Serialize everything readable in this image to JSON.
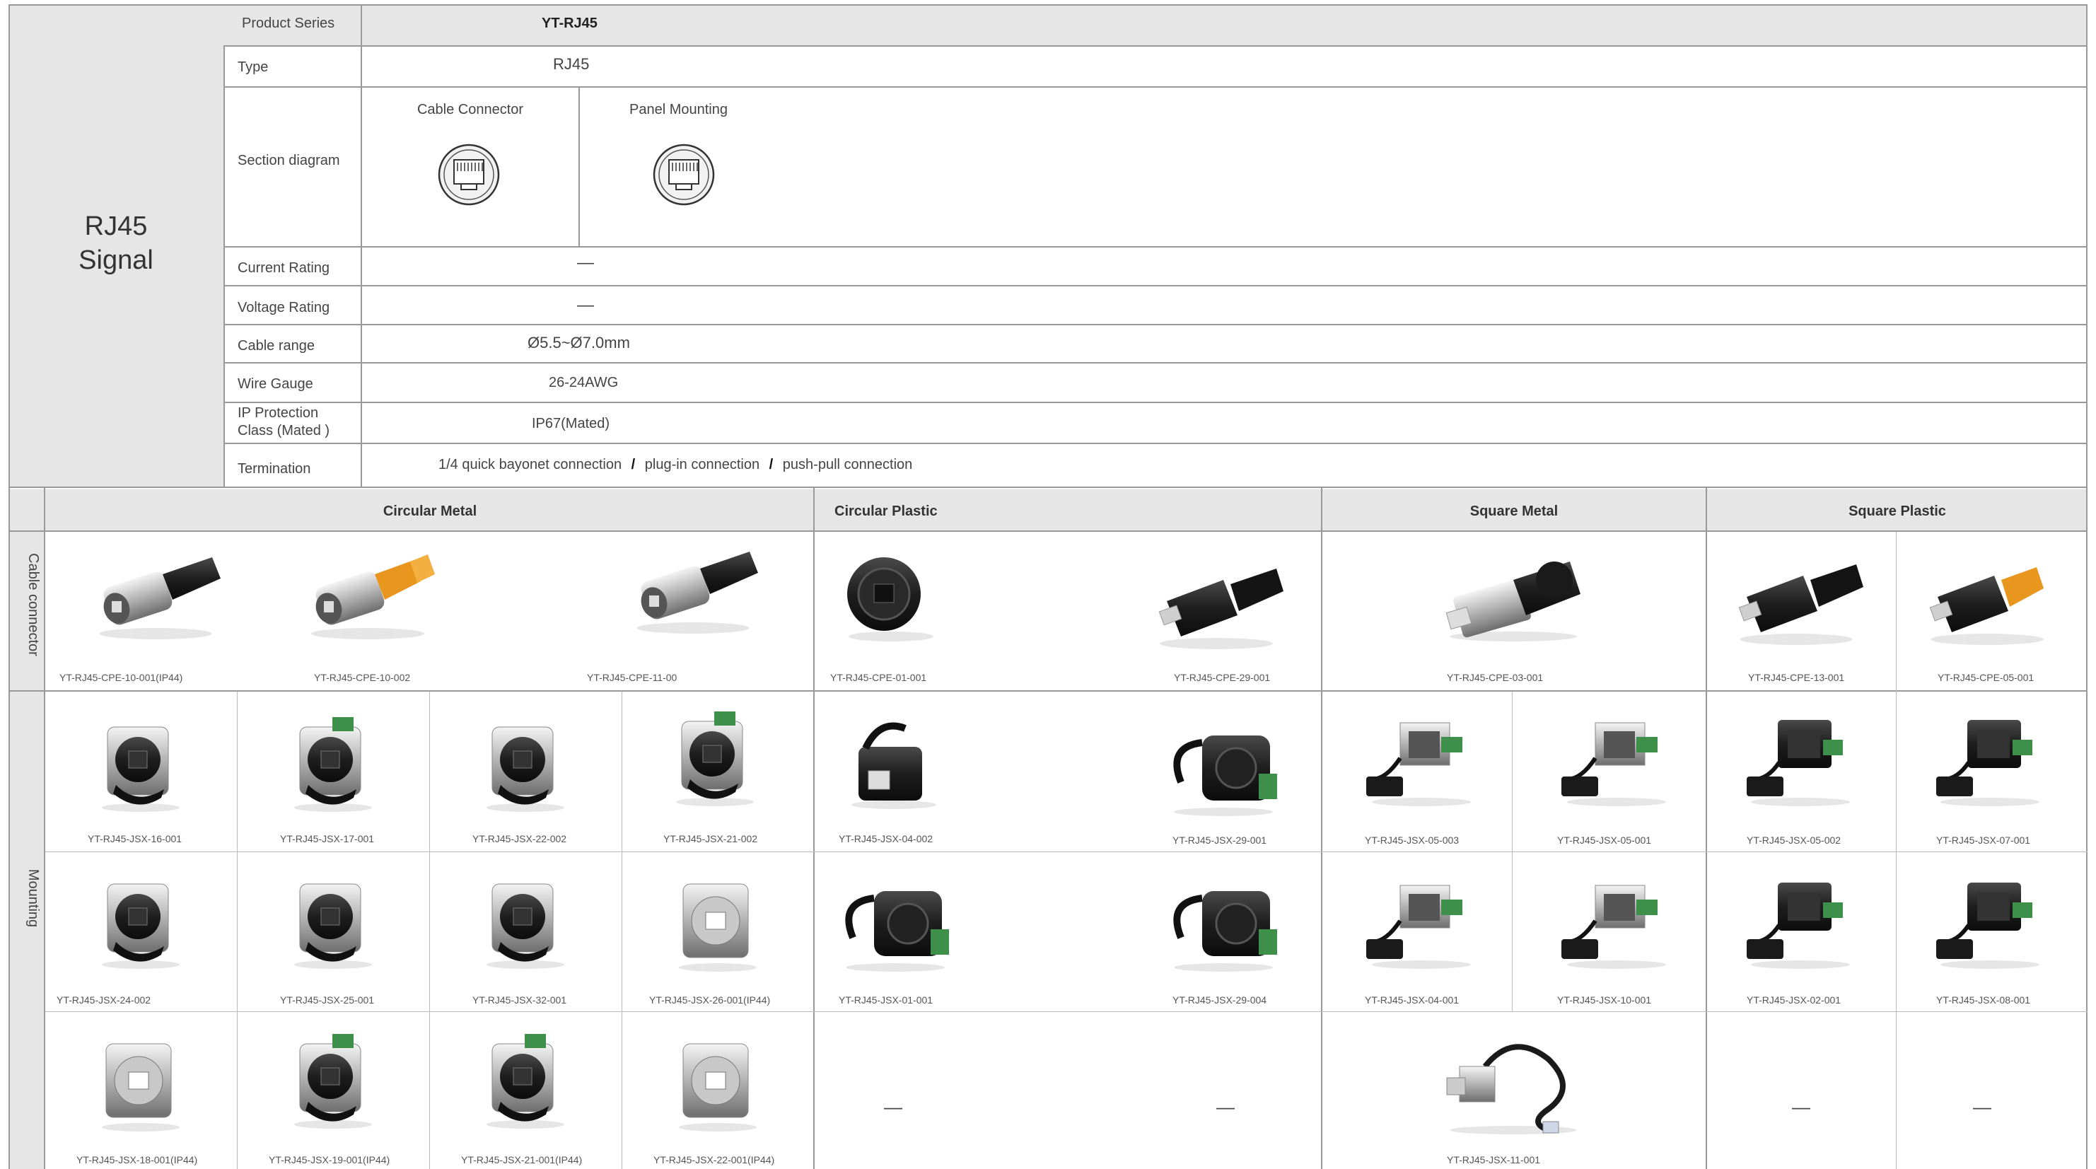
{
  "title": {
    "line1": "RJ45",
    "line2": "Signal"
  },
  "specs": {
    "product_series": {
      "label": "Product Series",
      "value": "YT-RJ45"
    },
    "type": {
      "label": "Type",
      "value": "RJ45"
    },
    "section_diagram": {
      "label": "Section diagram",
      "cable": "Cable Connector",
      "panel": "Panel Mounting"
    },
    "current": {
      "label": "Current Rating",
      "value": "—"
    },
    "voltage": {
      "label": "Voltage Rating",
      "value": "—"
    },
    "cable": {
      "label": "Cable range",
      "value": "Ø5.5~Ø7.0mm"
    },
    "gauge": {
      "label": "Wire Gauge",
      "value": "26-24AWG"
    },
    "ip": {
      "label": "IP Protection Class (Mated )",
      "value": "IP67(Mated)"
    },
    "termination": {
      "label": "Termination",
      "opt1": "1/4 quick bayonet connection",
      "opt2": "plug-in connection",
      "opt3": "push-pull connection",
      "sep": "/"
    }
  },
  "columns": {
    "circular_metal": "Circular Metal",
    "circular_plastic": "Circular Plastic",
    "square_metal": "Square Metal",
    "square_plastic": "Square Plastic"
  },
  "rows": {
    "cable": "Cable connector",
    "mounting": "Mounting"
  },
  "cable_connectors": {
    "cm1": "YT-RJ45-CPE-10-001(IP44)",
    "cm2": "YT-RJ45-CPE-10-002",
    "cm3": "YT-RJ45-CPE-11-00",
    "cp1": "YT-RJ45-CPE-01-001",
    "cp2": "YT-RJ45-CPE-29-001",
    "sm1": "YT-RJ45-CPE-03-001",
    "sp1": "YT-RJ45-CPE-13-001",
    "sp2": "YT-RJ45-CPE-05-001"
  },
  "mount_r1": {
    "a": "YT-RJ45-JSX-16-001",
    "b": "YT-RJ45-JSX-17-001",
    "c": "YT-RJ45-JSX-22-002",
    "d": "YT-RJ45-JSX-21-002",
    "e": "YT-RJ45-JSX-04-002",
    "f": "YT-RJ45-JSX-29-001",
    "g": "YT-RJ45-JSX-05-003",
    "h": "YT-RJ45-JSX-05-001",
    "i": "YT-RJ45-JSX-05-002",
    "j": "YT-RJ45-JSX-07-001"
  },
  "mount_r2": {
    "a": "YT-RJ45-JSX-24-002",
    "b": "YT-RJ45-JSX-25-001",
    "c": "YT-RJ45-JSX-32-001",
    "d": "YT-RJ45-JSX-26-001(IP44)",
    "e": "YT-RJ45-JSX-01-001",
    "f": "YT-RJ45-JSX-29-004",
    "g": "YT-RJ45-JSX-04-001",
    "h": "YT-RJ45-JSX-10-001",
    "i": "YT-RJ45-JSX-02-001",
    "j": "YT-RJ45-JSX-08-001"
  },
  "mount_r3": {
    "a": "YT-RJ45-JSX-18-001(IP44)",
    "b": "YT-RJ45-JSX-19-001(IP44)",
    "c": "YT-RJ45-JSX-21-001(IP44)",
    "d": "YT-RJ45-JSX-22-001(IP44)",
    "e": "—",
    "f": "—",
    "g": "YT-RJ45-JSX-11-001",
    "i": "—",
    "j": "—"
  },
  "colors": {
    "gray_bg": "#e6e6e6",
    "border": "#999999",
    "accent_orange": "#f0a030",
    "product_black": "#1e1e1e"
  }
}
